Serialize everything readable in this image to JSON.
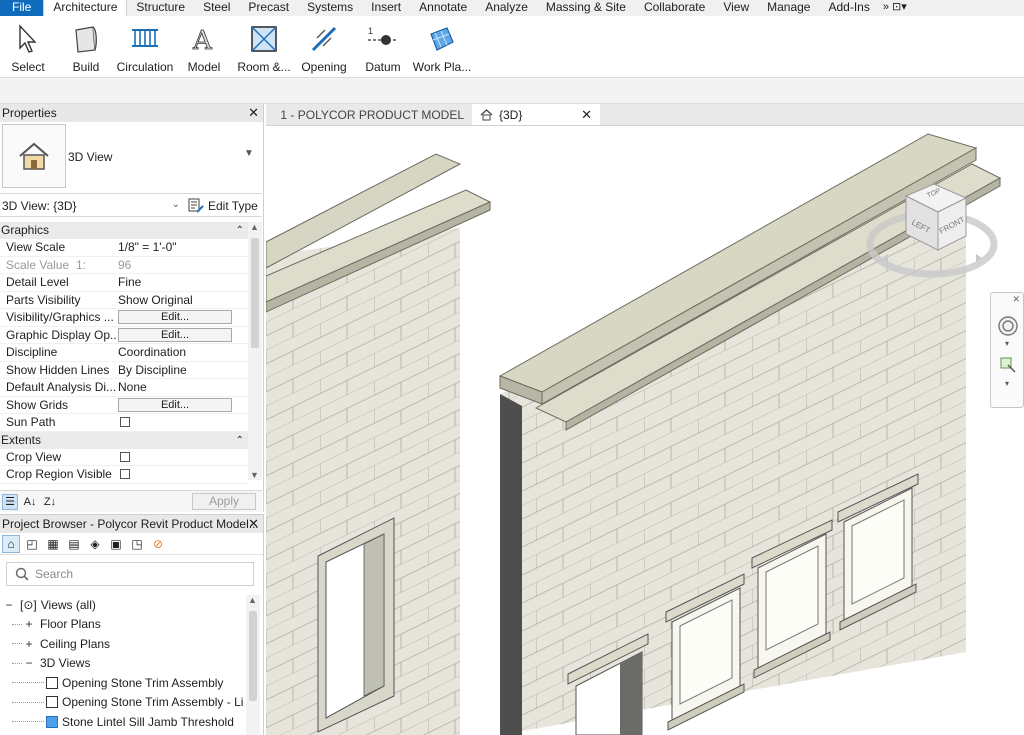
{
  "menu": {
    "tabs": [
      "File",
      "Architecture",
      "Structure",
      "Steel",
      "Precast",
      "Systems",
      "Insert",
      "Annotate",
      "Analyze",
      "Massing & Site",
      "Collaborate",
      "View",
      "Manage",
      "Add-Ins"
    ],
    "overflow_icon": "double-chevron-right-icon"
  },
  "ribbon": {
    "buttons": [
      {
        "label": "Select",
        "icon": "cursor-arrow-icon"
      },
      {
        "label": "Build",
        "icon": "wall-icon"
      },
      {
        "label": "Circulation",
        "icon": "railing-icon"
      },
      {
        "label": "Model",
        "icon": "model-text-icon"
      },
      {
        "label": "Room &...",
        "icon": "room-icon"
      },
      {
        "label": "Opening",
        "icon": "opening-icon"
      },
      {
        "label": "Datum",
        "icon": "datum-level-icon"
      },
      {
        "label": "Work Pla...",
        "icon": "work-plane-icon"
      }
    ]
  },
  "properties": {
    "title": "Properties",
    "type_name": "3D View",
    "instance_selector": "3D View: {3D}",
    "edit_type_label": "Edit Type",
    "graphics_category": "Graphics",
    "graphics_rows": [
      {
        "name": "View Scale",
        "value": "1/8\" = 1'-0\""
      },
      {
        "name": "Scale Value",
        "value": "96",
        "extra": "1:",
        "disabled": true
      },
      {
        "name": "Detail Level",
        "value": "Fine"
      },
      {
        "name": "Parts Visibility",
        "value": "Show Original"
      },
      {
        "name": "Visibility/Graphics ...",
        "value": "Edit...",
        "button": true
      },
      {
        "name": "Graphic Display Op...",
        "value": "Edit...",
        "button": true
      },
      {
        "name": "Discipline",
        "value": "Coordination"
      },
      {
        "name": "Show Hidden Lines",
        "value": "By Discipline"
      },
      {
        "name": "Default Analysis Di...",
        "value": "None"
      },
      {
        "name": "Show Grids",
        "value": "Edit...",
        "button": true
      },
      {
        "name": "Sun Path",
        "value": "",
        "checkbox": true
      }
    ],
    "extents_category": "Extents",
    "extents_rows": [
      {
        "name": "Crop View",
        "checkbox": true
      },
      {
        "name": "Crop Region Visible",
        "checkbox": true
      }
    ],
    "apply_label": "Apply"
  },
  "browser": {
    "title": "Project Browser - Polycor Revit Product Model...",
    "search_placeholder": "Search",
    "tree": [
      {
        "label": "Views (all)",
        "toggle": "−",
        "indent": 0,
        "icon": "view-icon"
      },
      {
        "label": "Floor Plans",
        "toggle": "+",
        "indent": 1
      },
      {
        "label": "Ceiling Plans",
        "toggle": "+",
        "indent": 1
      },
      {
        "label": "3D Views",
        "toggle": "−",
        "indent": 1
      },
      {
        "label": "Opening Stone Trim Assembly",
        "indent": 2,
        "icon": "3d-view-icon"
      },
      {
        "label": "Opening Stone Trim Assembly - Li",
        "indent": 2,
        "icon": "3d-view-icon"
      },
      {
        "label": "Stone Lintel Sill Jamb Threshold",
        "indent": 2,
        "icon": "3d-view-icon",
        "selected": true
      }
    ]
  },
  "view_tabs": [
    {
      "label": "1 - POLYCOR PRODUCT MODEL",
      "icon": "sheet-icon"
    },
    {
      "label": "{3D}",
      "icon": "house-icon",
      "active": true
    }
  ],
  "viewcube": {
    "top": "TOP",
    "left": "LEFT",
    "front": "FRONT"
  }
}
